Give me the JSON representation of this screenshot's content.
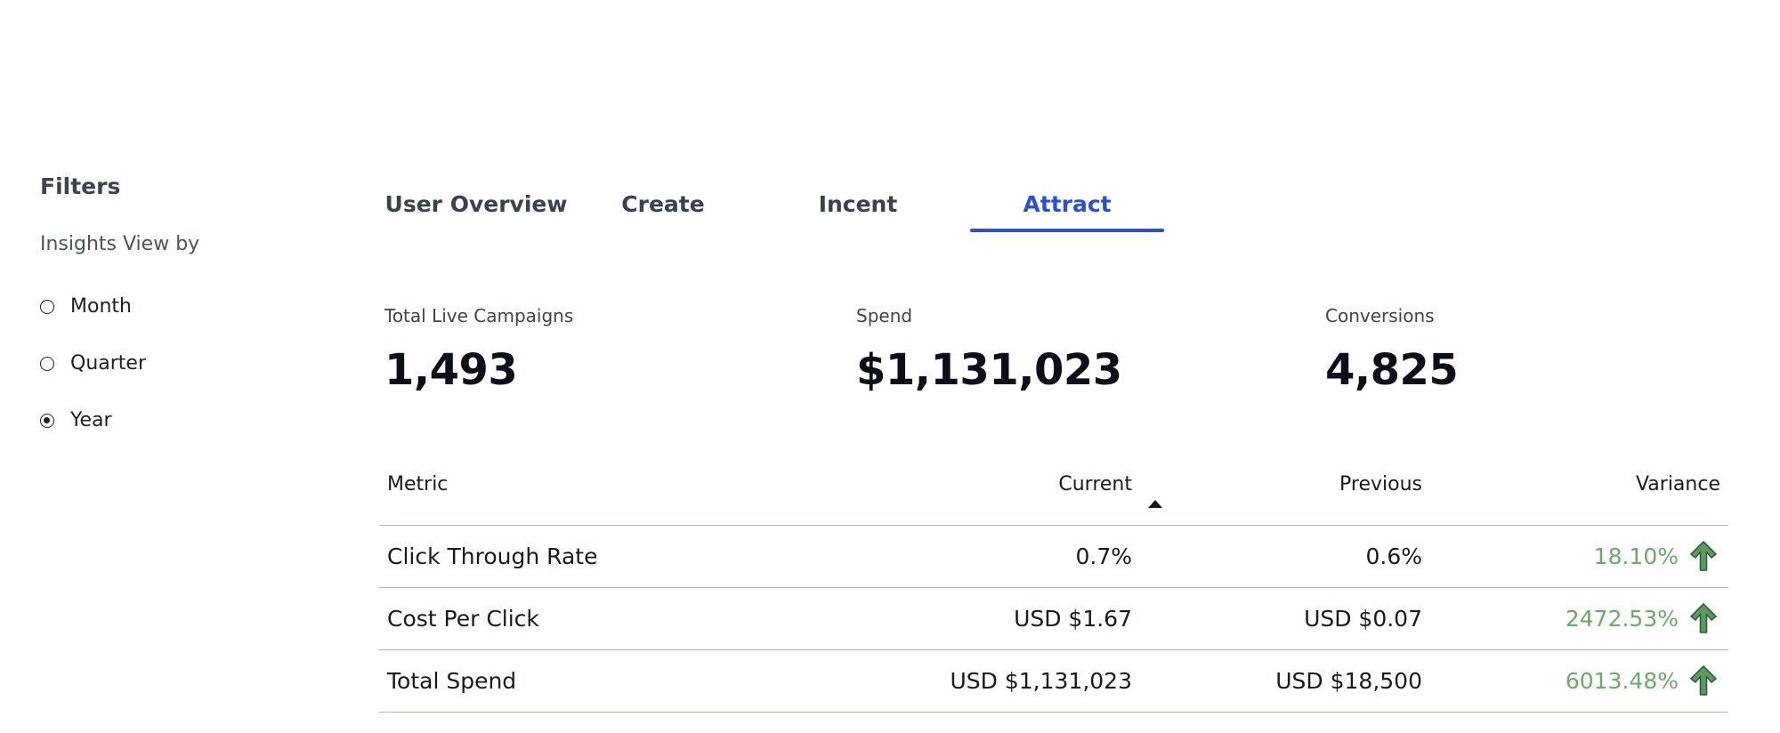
{
  "sidebar": {
    "title": "Filters",
    "insights_label": "Insights View by",
    "options": [
      {
        "label": "Month",
        "selected": false
      },
      {
        "label": "Quarter",
        "selected": false
      },
      {
        "label": "Year",
        "selected": true
      }
    ]
  },
  "tabs": [
    {
      "label": "User Overview",
      "active": false
    },
    {
      "label": "Create",
      "active": false
    },
    {
      "label": "Incent",
      "active": false
    },
    {
      "label": "Attract",
      "active": true
    }
  ],
  "kpis": [
    {
      "label": "Total Live Campaigns",
      "value": "1,493"
    },
    {
      "label": "Spend",
      "value": "$1,131,023"
    },
    {
      "label": "Conversions",
      "value": "4,825"
    }
  ],
  "table": {
    "headers": {
      "metric": "Metric",
      "current": "Current",
      "previous": "Previous",
      "variance": "Variance"
    },
    "sort_column": "current",
    "rows": [
      {
        "metric": "Click Through Rate",
        "current": "0.7%",
        "previous": "0.6%",
        "variance": "18.10%",
        "trend_icon": "arrow-up-icon"
      },
      {
        "metric": "Cost Per Click",
        "current": "USD $1.67",
        "previous": "USD $0.07",
        "variance": "2472.53%",
        "trend_icon": "arrow-up-icon"
      },
      {
        "metric": "Total Spend",
        "current": "USD $1,131,023",
        "previous": "USD $18,500",
        "variance": "6013.48%",
        "trend_icon": "arrow-up-icon"
      }
    ]
  },
  "colors": {
    "accent": "#2b4fd3",
    "positive": "#6aaa64",
    "arrow_fill": "#5e9a5f",
    "arrow_stroke": "#2f5e3a"
  }
}
